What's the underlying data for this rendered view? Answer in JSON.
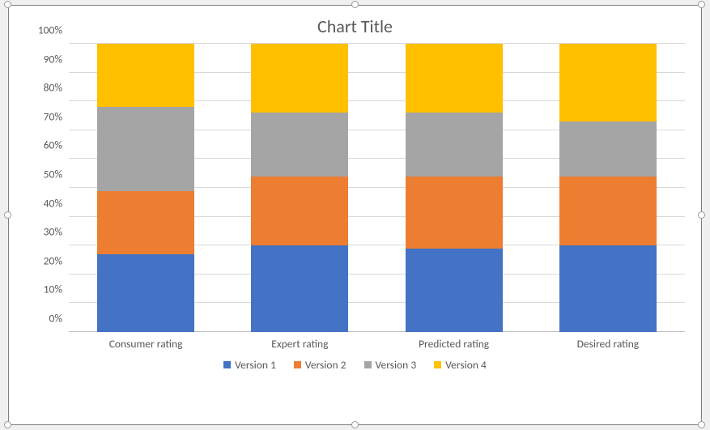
{
  "chart_data": {
    "type": "bar",
    "stacking": "percent",
    "title": "Chart Title",
    "xlabel": "",
    "ylabel": "",
    "ylim": [
      0,
      100
    ],
    "categories": [
      "Consumer rating",
      "Expert rating",
      "Predicted rating",
      "Desired rating"
    ],
    "series": [
      {
        "name": "Version 1",
        "color": "#4472C4",
        "values": [
          27,
          30,
          29,
          30
        ]
      },
      {
        "name": "Version 2",
        "color": "#ED7D31",
        "values": [
          22,
          24,
          25,
          24
        ]
      },
      {
        "name": "Version 3",
        "color": "#A5A5A5",
        "values": [
          29,
          22,
          22,
          19
        ]
      },
      {
        "name": "Version 4",
        "color": "#FFC000",
        "values": [
          22,
          24,
          24,
          27
        ]
      }
    ],
    "y_ticks": [
      "0%",
      "10%",
      "20%",
      "30%",
      "40%",
      "50%",
      "60%",
      "70%",
      "80%",
      "90%",
      "100%"
    ]
  }
}
